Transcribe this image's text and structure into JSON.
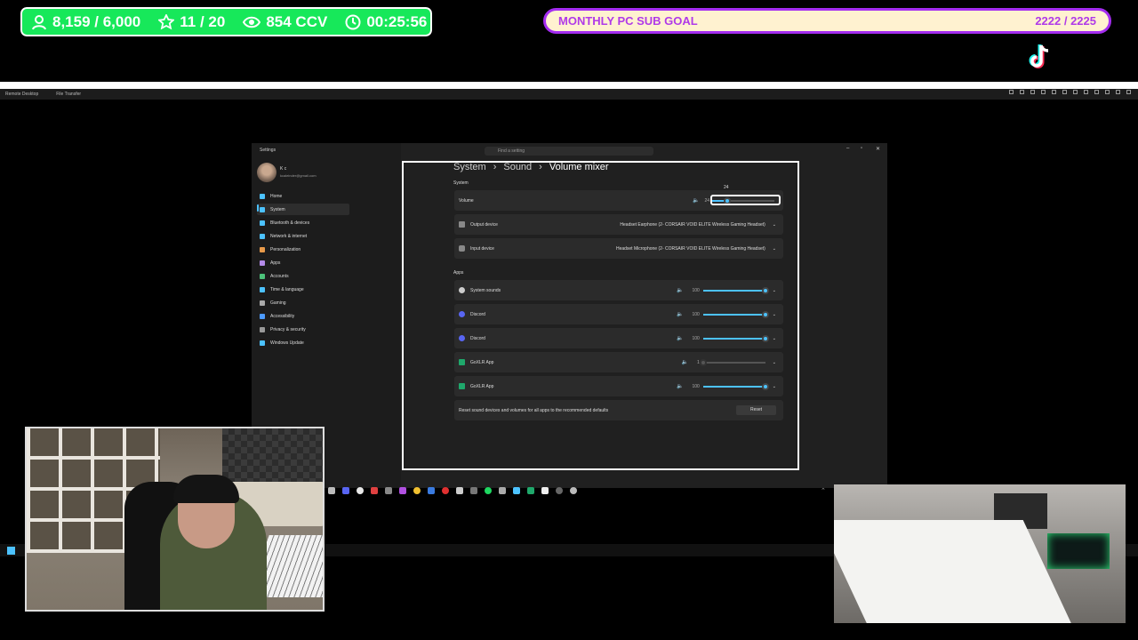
{
  "overlay": {
    "stats": {
      "followers": "8,159 / 6,000",
      "stars": "11 / 20",
      "viewers": "854 CCV",
      "timer": "00:25:56"
    },
    "goal": {
      "label": "MONTHLY PC SUB GOAL",
      "value": "2222 / 2225"
    }
  },
  "remote_desktop": {
    "menu": [
      "Remote Desktop",
      "File Transfer"
    ]
  },
  "settings": {
    "window_title": "Settings",
    "search_placeholder": "Find a setting",
    "user": {
      "name": "K c",
      "email": "kcaleinder@gmail.com"
    },
    "nav": [
      {
        "label": "Home",
        "color": "#4cc2ff"
      },
      {
        "label": "System",
        "color": "#4cc2ff"
      },
      {
        "label": "Bluetooth & devices",
        "color": "#4cc2ff"
      },
      {
        "label": "Network & internet",
        "color": "#4cc2ff"
      },
      {
        "label": "Personalization",
        "color": "#e89a4a"
      },
      {
        "label": "Apps",
        "color": "#b38ae8"
      },
      {
        "label": "Accounts",
        "color": "#4cc27a"
      },
      {
        "label": "Time & language",
        "color": "#4cc2ff"
      },
      {
        "label": "Gaming",
        "color": "#aaaaaa"
      },
      {
        "label": "Accessibility",
        "color": "#4c9aff"
      },
      {
        "label": "Privacy & security",
        "color": "#999999"
      },
      {
        "label": "Windows Update",
        "color": "#4cc2ff"
      }
    ],
    "breadcrumb": [
      "System",
      "Sound",
      "Volume mixer"
    ],
    "system_header": "System",
    "volume": {
      "label": "Volume",
      "value": "24",
      "level": 0.24
    },
    "output": {
      "label": "Output device",
      "value": "Headset Earphone (2- CORSAIR VOID ELITE Wireless Gaming Headset)"
    },
    "input": {
      "label": "Input device",
      "value": "Headset Microphone (2- CORSAIR VOID ELITE Wireless Gaming Headset)"
    },
    "apps_header": "Apps",
    "apps": [
      {
        "name": "System sounds",
        "value": "100",
        "level": 1.0,
        "color": "#cccccc"
      },
      {
        "name": "Discord",
        "value": "100",
        "level": 1.0,
        "color": "#5865f2"
      },
      {
        "name": "Discord",
        "value": "100",
        "level": 1.0,
        "color": "#5865f2"
      },
      {
        "name": "GoXLR App",
        "value": "1",
        "level": 0.01,
        "color": "#1fa86b"
      },
      {
        "name": "GoXLR App",
        "value": "100",
        "level": 1.0,
        "color": "#1fa86b"
      }
    ],
    "reset_text": "Reset sound devices and volumes for all apps to the recommended defaults",
    "reset_button": "Reset"
  },
  "colors": {
    "accent": "#4cc2ff",
    "stats_bg": "#17e85a",
    "goal_border": "#a42cf0"
  }
}
